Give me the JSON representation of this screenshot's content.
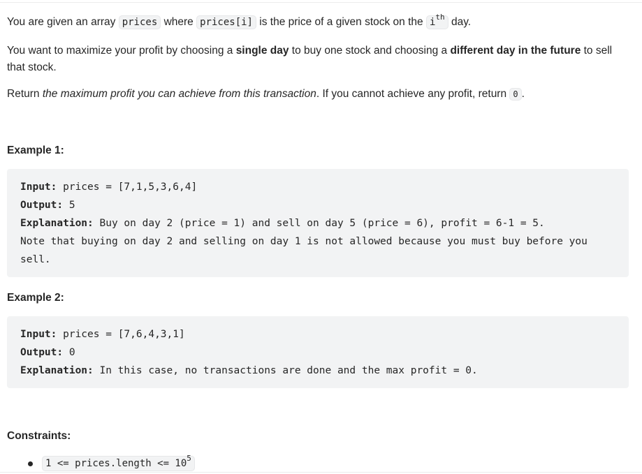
{
  "intro": {
    "p1_a": "You are given an array ",
    "p1_code1": "prices",
    "p1_b": " where ",
    "p1_code2": "prices[i]",
    "p1_c": " is the price of a given stock on the ",
    "p1_code3_base": "i",
    "p1_code3_sup": "th",
    "p1_d": " day.",
    "p2_a": "You want to maximize your profit by choosing a ",
    "p2_bold1": "single day",
    "p2_b": " to buy one stock and choosing a ",
    "p2_bold2": "different day in the future",
    "p2_c": " to sell that stock.",
    "p3_a": "Return ",
    "p3_em": "the maximum profit you can achieve from this transaction",
    "p3_b": ". If you cannot achieve any profit, return ",
    "p3_code": "0",
    "p3_c": "."
  },
  "examples": [
    {
      "heading": "Example 1:",
      "input_label": "Input:",
      "input_value": " prices = [7,1,5,3,6,4]",
      "output_label": "Output:",
      "output_value": " 5",
      "explanation_label": "Explanation:",
      "explanation_value": " Buy on day 2 (price = 1) and sell on day 5 (price = 6), profit = 6-1 = 5.",
      "note_line1": "Note that buying on day 2 and selling on day 1 is not allowed because you must buy before you",
      "note_line2": "sell."
    },
    {
      "heading": "Example 2:",
      "input_label": "Input:",
      "input_value": " prices = [7,6,4,3,1]",
      "output_label": "Output:",
      "output_value": " 0",
      "explanation_label": "Explanation:",
      "explanation_value": " In this case, no transactions are done and the max profit = 0."
    }
  ],
  "constraints": {
    "heading": "Constraints:",
    "items": [
      {
        "code_base": "1 <= prices.length <= 10",
        "code_sup": "5"
      }
    ]
  }
}
